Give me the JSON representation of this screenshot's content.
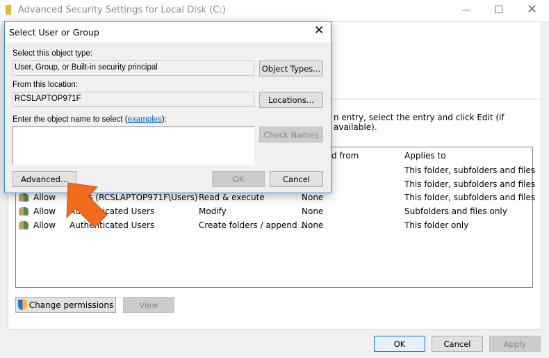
{
  "window": {
    "title": "Advanced Security Settings for Local Disk (C:)",
    "minimize_icon": "minimize-icon",
    "maximize_icon": "maximize-icon",
    "close_icon": "close-icon",
    "hint": "n entry, select the entry and click Edit (if available).",
    "table": {
      "headers": {
        "inherited": "d from",
        "applies": "Applies to"
      },
      "rows": [
        {
          "type": "",
          "principal": "",
          "access": "",
          "inherited": "",
          "applies": "This folder, subfolders and files"
        },
        {
          "type": "",
          "principal": "",
          "access": "",
          "inherited": "",
          "applies": "This folder, subfolders and files"
        },
        {
          "type": "Allow",
          "principal": "Users (RCSLAPTOP971F\\Users)",
          "access": "Read & execute",
          "inherited": "None",
          "applies": "This folder, subfolders and files"
        },
        {
          "type": "Allow",
          "principal": "Authenticated Users",
          "access": "Modify",
          "inherited": "None",
          "applies": "Subfolders and files only"
        },
        {
          "type": "Allow",
          "principal": "Authenticated Users",
          "access": "Create folders / append ...",
          "inherited": "None",
          "applies": "This folder only"
        }
      ]
    },
    "change_permissions": "Change permissions",
    "view": "View",
    "ok": "OK",
    "cancel": "Cancel",
    "apply": "Apply"
  },
  "dialog": {
    "title": "Select User or Group",
    "object_type_label": "Select this object type:",
    "object_type_value": "User, Group, or Built-in security principal",
    "object_types_button": "Object Types...",
    "location_label": "From this location:",
    "location_value": "RCSLAPTOP971F",
    "locations_button": "Locations...",
    "name_label_pre": "Enter the object name to select (",
    "name_label_link": "examples",
    "name_label_post": "):",
    "name_value": "",
    "check_names": "Check Names",
    "advanced": "Advanced...",
    "ok": "OK",
    "cancel": "Cancel"
  },
  "colors": {
    "accent": "#0078d7",
    "arrow": "#f26b1d",
    "link": "#0066cc"
  }
}
